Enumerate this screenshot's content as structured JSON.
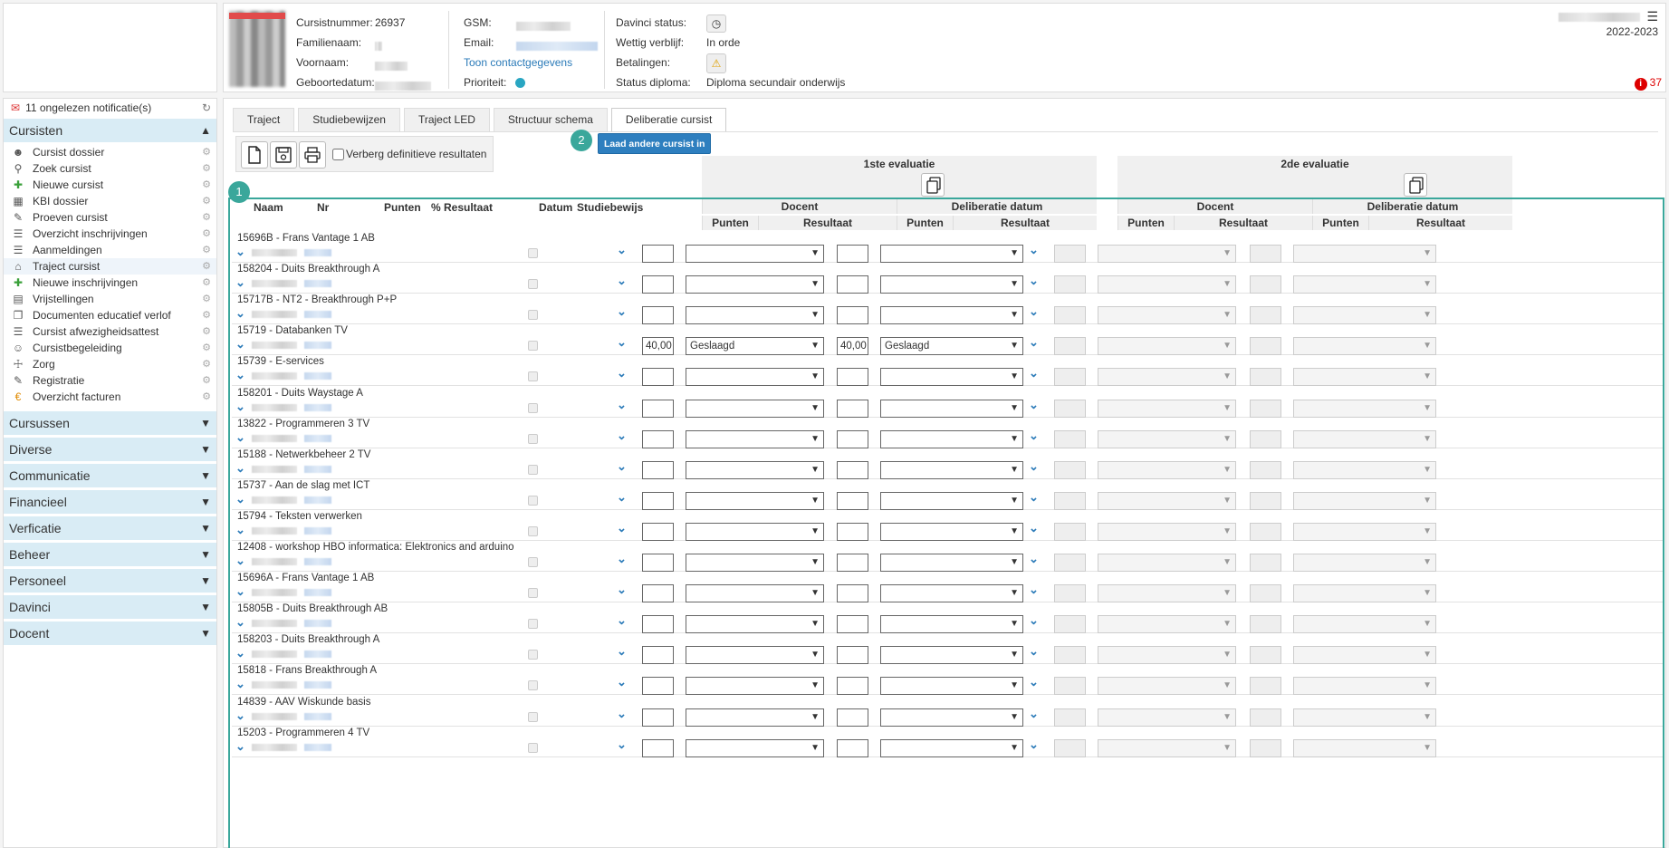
{
  "header": {
    "labels": {
      "cursistnummer": "Cursistnummer:",
      "familienaam": "Familienaam:",
      "voornaam": "Voornaam:",
      "geboortedatum": "Geboortedatum:",
      "gsm": "GSM:",
      "email": "Email:",
      "contact_link": "Toon contactgegevens",
      "prioriteit": "Prioriteit:",
      "davinci_status": "Davinci status:",
      "wettig_verblijf": "Wettig verblijf:",
      "betalingen": "Betalingen:",
      "status_diploma": "Status diploma:"
    },
    "values": {
      "cursistnummer": "26937",
      "wettig_verblijf": "In orde",
      "status_diploma": "Diploma secundair onderwijs"
    },
    "school_year": "2022-2023",
    "alert_count": "37",
    "priority_color": "#29a6c2"
  },
  "sidebar": {
    "notifications": "11 ongelezen notificatie(s)",
    "open_section": "Cursisten",
    "items": [
      {
        "label": "Cursist dossier",
        "icon": "person-icon"
      },
      {
        "label": "Zoek cursist",
        "icon": "search-icon"
      },
      {
        "label": "Nieuwe cursist",
        "icon": "add-person-icon"
      },
      {
        "label": "KBI dossier",
        "icon": "building-icon"
      },
      {
        "label": "Proeven cursist",
        "icon": "pencil-icon"
      },
      {
        "label": "Overzicht inschrijvingen",
        "icon": "list-icon"
      },
      {
        "label": "Aanmeldingen",
        "icon": "list-icon"
      },
      {
        "label": "Traject cursist",
        "icon": "route-icon"
      },
      {
        "label": "Nieuwe inschrijvingen",
        "icon": "plus-icon"
      },
      {
        "label": "Vrijstellingen",
        "icon": "document-icon"
      },
      {
        "label": "Documenten educatief verlof",
        "icon": "copy-icon"
      },
      {
        "label": "Cursist afwezigheidsattest",
        "icon": "list-icon"
      },
      {
        "label": "Cursistbegeleiding",
        "icon": "group-icon"
      },
      {
        "label": "Zorg",
        "icon": "medical-icon"
      },
      {
        "label": "Registratie",
        "icon": "edit-icon"
      },
      {
        "label": "Overzicht facturen",
        "icon": "euro-icon"
      }
    ],
    "active_item": "Traject cursist",
    "sections": [
      "Cursussen",
      "Diverse",
      "Communicatie",
      "Financieel",
      "Verficatie",
      "Beheer",
      "Personeel",
      "Davinci",
      "Docent"
    ]
  },
  "tabs": [
    "Traject",
    "Studiebewijzen",
    "Traject LED",
    "Structuur schema",
    "Deliberatie cursist"
  ],
  "active_tab": "Deliberatie cursist",
  "toolbar": {
    "hide_final_label": "Verberg definitieve resultaten",
    "load_other_button": "Laad andere cursist in",
    "badge1": "1",
    "badge2": "2"
  },
  "grid": {
    "eval1_title": "1ste evaluatie",
    "eval2_title": "2de evaluatie",
    "col_naam": "Naam",
    "col_nr": "Nr",
    "col_punten": "Punten",
    "col_resultaat": "% Resultaat",
    "col_datum": "Datum",
    "col_studiebewijs": "Studiebewijs",
    "docent": "Docent",
    "deliberatie_datum": "Deliberatie datum",
    "punten": "Punten",
    "resultaat": "Resultaat",
    "rows": [
      {
        "course": "15696B - Frans Vantage 1 AB",
        "p1": "",
        "r1": "",
        "p2": "",
        "r2": ""
      },
      {
        "course": "158204 - Duits Breakthrough A",
        "p1": "",
        "r1": "",
        "p2": "",
        "r2": ""
      },
      {
        "course": "15717B - NT2 - Breakthrough P+P",
        "p1": "",
        "r1": "",
        "p2": "",
        "r2": ""
      },
      {
        "course": "15719 - Databanken TV",
        "p1": "40,00",
        "r1": "Geslaagd",
        "p2": "40,00",
        "r2": "Geslaagd"
      },
      {
        "course": "15739 - E-services",
        "p1": "",
        "r1": "",
        "p2": "",
        "r2": ""
      },
      {
        "course": "158201 - Duits Waystage A",
        "p1": "",
        "r1": "",
        "p2": "",
        "r2": ""
      },
      {
        "course": "13822 - Programmeren 3 TV",
        "p1": "",
        "r1": "",
        "p2": "",
        "r2": ""
      },
      {
        "course": "15188 - Netwerkbeheer 2 TV",
        "p1": "",
        "r1": "",
        "p2": "",
        "r2": ""
      },
      {
        "course": "15737 - Aan de slag met ICT",
        "p1": "",
        "r1": "",
        "p2": "",
        "r2": ""
      },
      {
        "course": "15794 - Teksten verwerken",
        "p1": "",
        "r1": "",
        "p2": "",
        "r2": ""
      },
      {
        "course": "12408 - workshop HBO informatica: Elektronics and arduino",
        "p1": "",
        "r1": "",
        "p2": "",
        "r2": ""
      },
      {
        "course": "15696A - Frans Vantage 1 AB",
        "p1": "",
        "r1": "",
        "p2": "",
        "r2": ""
      },
      {
        "course": "15805B - Duits Breakthrough AB",
        "p1": "",
        "r1": "",
        "p2": "",
        "r2": ""
      },
      {
        "course": "158203 - Duits Breakthrough A",
        "p1": "",
        "r1": "",
        "p2": "",
        "r2": ""
      },
      {
        "course": "15818 - Frans Breakthrough A",
        "p1": "",
        "r1": "",
        "p2": "",
        "r2": ""
      },
      {
        "course": "14839 - AAV Wiskunde basis",
        "p1": "",
        "r1": "",
        "p2": "",
        "r2": ""
      },
      {
        "course": "15203 - Programmeren 4 TV",
        "p1": "",
        "r1": "",
        "p2": "",
        "r2": ""
      }
    ]
  }
}
